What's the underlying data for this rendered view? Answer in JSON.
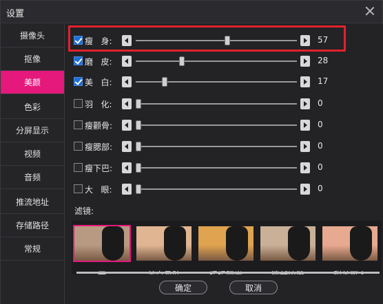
{
  "window": {
    "title": "设置"
  },
  "sidebar": {
    "items": [
      {
        "label": "摄像头"
      },
      {
        "label": "抠像"
      },
      {
        "label": "美颜",
        "active": true
      },
      {
        "label": "色彩"
      },
      {
        "label": "分屏显示"
      },
      {
        "label": "视频"
      },
      {
        "label": "音频"
      },
      {
        "label": "推流地址"
      },
      {
        "label": "存储路径"
      },
      {
        "label": "常规"
      }
    ]
  },
  "beauty": {
    "sliders": [
      {
        "label": "瘦   身:",
        "checked": true,
        "value": "57",
        "fraction": 0.57
      },
      {
        "label": "磨   皮:",
        "checked": true,
        "value": "28",
        "fraction": 0.28
      },
      {
        "label": "美   白:",
        "checked": true,
        "value": "17",
        "fraction": 0.17
      },
      {
        "label": "羽   化:",
        "checked": false,
        "value": "0",
        "fraction": 0
      },
      {
        "label": "瘦颧骨:",
        "checked": false,
        "value": "0",
        "fraction": 0
      },
      {
        "label": "瘦腮部:",
        "checked": false,
        "value": "0",
        "fraction": 0
      },
      {
        "label": "瘦下巴:",
        "checked": false,
        "value": "0",
        "fraction": 0
      },
      {
        "label": "大   眼:",
        "checked": false,
        "value": "0",
        "fraction": 0
      }
    ],
    "filters_label": "滤镜:",
    "filters": [
      {
        "name": "无",
        "selected": true,
        "tint": "#b89a82"
      },
      {
        "name": "美白柔肤",
        "selected": false,
        "tint": "#e0b692"
      },
      {
        "name": "暖暖阳光",
        "selected": false,
        "tint": "#e0a350"
      },
      {
        "name": "清新淡雅",
        "selected": false,
        "tint": "#c9b097"
      },
      {
        "name": "甜美可人",
        "selected": false,
        "tint": "#e7a98f"
      }
    ]
  },
  "buttons": {
    "ok": "确定",
    "cancel": "取消"
  },
  "colors": {
    "accent": "#e5187c",
    "highlight": "#e3212b",
    "checkbox": "#1f6fd6"
  }
}
